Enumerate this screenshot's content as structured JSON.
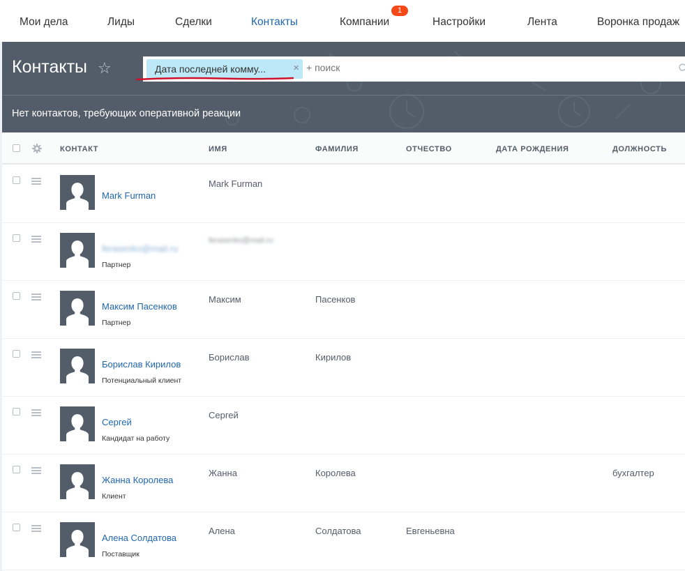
{
  "nav": {
    "tabs": [
      {
        "label": "Мои дела"
      },
      {
        "label": "Лиды"
      },
      {
        "label": "Сделки"
      },
      {
        "label": "Контакты",
        "active": true
      },
      {
        "label": "Компании",
        "badge": "1"
      },
      {
        "label": "Настройки"
      },
      {
        "label": "Лента"
      },
      {
        "label": "Воронка продаж"
      }
    ]
  },
  "header": {
    "title": "Контакты",
    "filter_chip": "Дата последней комму...",
    "search_placeholder": "+ поиск",
    "notice": "Нет контактов, требующих оперативной реакции"
  },
  "table": {
    "columns": [
      "Контакт",
      "Имя",
      "Фамилия",
      "Отчество",
      "Дата рождения",
      "Должность"
    ],
    "rows": [
      {
        "contact": "Mark Furman",
        "type": "",
        "first": "Mark Furman",
        "last": "",
        "middle": "",
        "birthday": "",
        "position": ""
      },
      {
        "contact": "ferasenko@mail.ru",
        "type": "Партнер",
        "first": "ferasenko@mail.ru",
        "last": "",
        "middle": "",
        "birthday": "",
        "position": "",
        "blurred": true
      },
      {
        "contact": "Максим Пасенков",
        "type": "Партнер",
        "first": "Максим",
        "last": "Пасенков",
        "middle": "",
        "birthday": "",
        "position": ""
      },
      {
        "contact": "Борислав Кирилов",
        "type": "Потенциальный клиент",
        "first": "Борислав",
        "last": "Кирилов",
        "middle": "",
        "birthday": "",
        "position": ""
      },
      {
        "contact": "Сергей",
        "type": "Кандидат на работу",
        "first": "Сергей",
        "last": "",
        "middle": "",
        "birthday": "",
        "position": ""
      },
      {
        "contact": "Жанна Королева",
        "type": "Клиент",
        "first": "Жанна",
        "last": "Королева",
        "middle": "",
        "birthday": "",
        "position": "бухгалтер"
      },
      {
        "contact": "Алена Солдатова",
        "type": "Поставщик",
        "first": "Алена",
        "last": "Солдатова",
        "middle": "Евгеньевна",
        "birthday": "",
        "position": ""
      }
    ]
  },
  "colors": {
    "accent": "#2067b0",
    "header_bg": "#535c69",
    "badge": "#f54819",
    "filter_chip": "#bde8f7",
    "annotation": "#d0102a"
  }
}
